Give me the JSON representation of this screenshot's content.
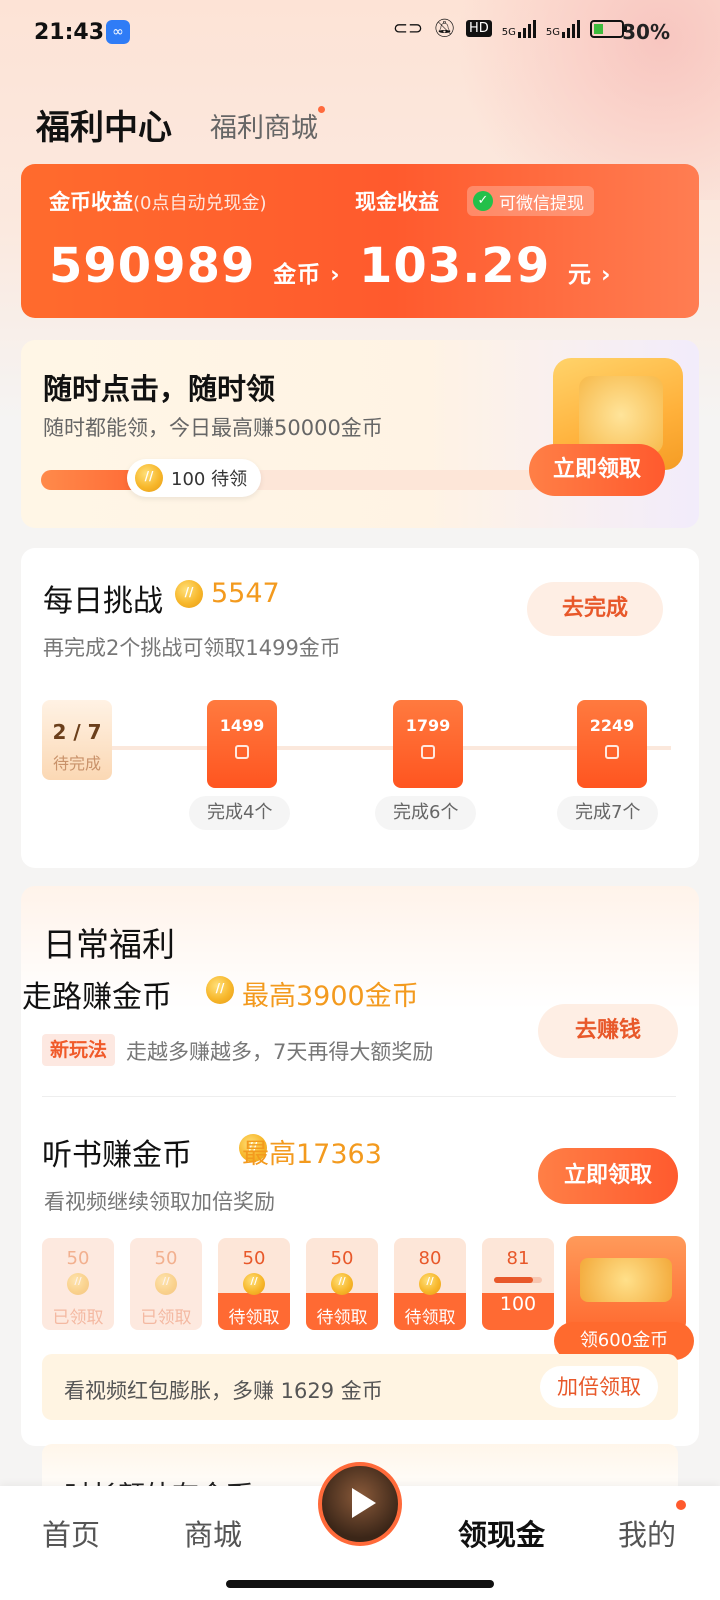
{
  "status_bar": {
    "time": "21:43",
    "battery": "30%",
    "net1": "5G",
    "net2": "5G",
    "hd": "HD"
  },
  "header": {
    "title": "福利中心",
    "mall_tab": "福利商城"
  },
  "earnings": {
    "coin_label": "金币收益",
    "coin_note": "(0点自动兑现金)",
    "coin_value": "590989",
    "coin_unit": "金币",
    "cash_label": "现金收益",
    "wechat_tag": "可微信提现",
    "cash_value": "103.29",
    "cash_unit": "元"
  },
  "anytime": {
    "title": "随时点击，随时领",
    "desc": "随时都能领，今日最高赚50000金币",
    "pending": "100 待领",
    "progress": 0.2,
    "button": "立即领取"
  },
  "challenge": {
    "title": "每日挑战",
    "coins": "5547",
    "desc": "再完成2个挑战可领取1499金币",
    "button": "去完成",
    "current": "2 / 7",
    "current_status": "待完成",
    "milestones": [
      {
        "reward": "1499",
        "label": "完成4个"
      },
      {
        "reward": "1799",
        "label": "完成6个"
      },
      {
        "reward": "2249",
        "label": "完成7个"
      }
    ]
  },
  "welfare": {
    "title": "日常福利",
    "walk": {
      "title": "走路赚金币",
      "max": "最高3900金币",
      "tag": "新玩法",
      "desc": "走越多赚越多，7天再得大额奖励",
      "button": "去赚钱"
    },
    "listen": {
      "title": "听书赚金币",
      "max": "最高17363",
      "desc": "看视频继续领取加倍奖励",
      "button": "立即领取"
    },
    "tiles": [
      {
        "value": "50",
        "status": "已领取"
      },
      {
        "value": "50",
        "status": "已领取"
      },
      {
        "value": "50",
        "status": "待领取"
      },
      {
        "value": "50",
        "status": "待领取"
      },
      {
        "value": "80",
        "status": "待领取"
      }
    ],
    "current_tile": {
      "value": "81",
      "target": "100",
      "progress": 0.81
    },
    "chest_label": "领600金币",
    "boost": {
      "text": "看视频红包膨胀，多赚 1629 金币",
      "button": "加倍领取"
    },
    "next_title": "时长额外有金币"
  },
  "nav": {
    "home": "首页",
    "mall": "商城",
    "cash": "领现金",
    "me": "我的"
  },
  "colors": {
    "accent": "#ff5a2d",
    "gold": "#f39a1e"
  }
}
